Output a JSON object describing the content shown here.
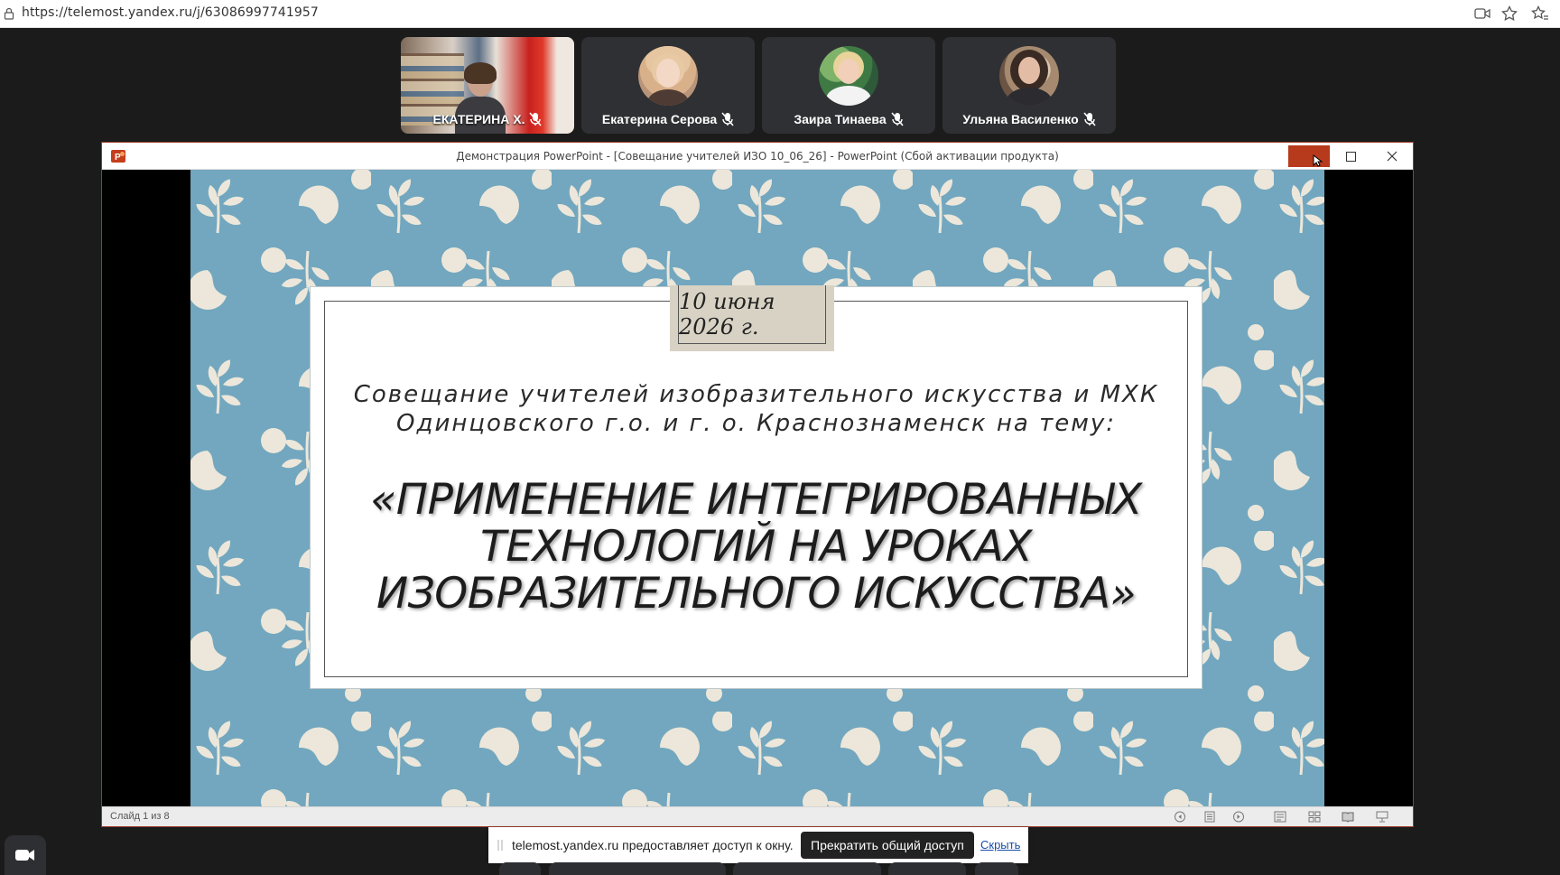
{
  "browser": {
    "url": "https://telemost.yandex.ru/j/63086997741957",
    "icons": [
      "lock-icon",
      "camera-permission-icon",
      "bookmark-star-icon",
      "favorites-icon"
    ]
  },
  "participants": [
    {
      "name": "ЕКАТЕРИНА Х.",
      "mic": "muted",
      "kind": "video"
    },
    {
      "name": "Екатерина Серова",
      "mic": "muted",
      "kind": "avatar"
    },
    {
      "name": "Заира Тинаева",
      "mic": "muted",
      "kind": "avatar"
    },
    {
      "name": "Ульяна Василенко",
      "mic": "muted",
      "kind": "avatar"
    }
  ],
  "ppt": {
    "window_title": "Демонстрация PowerPoint - [Совещание учителей ИЗО 10_06_26] - PowerPoint (Сбой активации продукта)",
    "status": "Слайд 1 из 8",
    "accent_color": "#b73a1d",
    "slide": {
      "date": "10 июня 2026 г.",
      "subtitle_line1": "Совещание учителей изобразительного искусства и МХК",
      "subtitle_line2": "Одинцовского г.о. и г. о. Краснознаменск на тему:",
      "title_line1": "«ПРИМЕНЕНИЕ ИНТЕГРИРОВАННЫХ",
      "title_line2": "ТЕХНОЛОГИЙ НА УРОКАХ",
      "title_line3": "ИЗОБРАЗИТЕЛЬНОГО ИСКУССТВА»",
      "background_color": "#72a7bf",
      "pattern_color": "#ece7da"
    }
  },
  "share": {
    "text": "telemost.yandex.ru предоставляет доступ к окну.",
    "stop_label": "Прекратить общий доступ",
    "hide_label": "Скрыть"
  }
}
